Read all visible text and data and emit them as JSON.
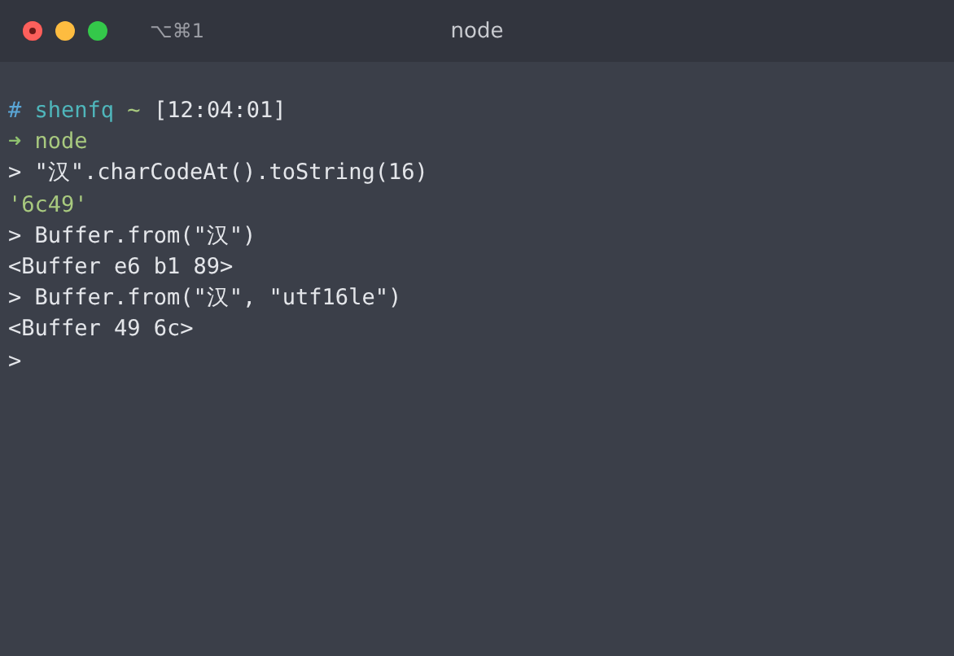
{
  "window": {
    "title": "node",
    "shortcut": "⌥⌘1"
  },
  "lines": [
    {
      "segments": [
        {
          "kind": "hash",
          "text": "#"
        },
        {
          "kind": "user",
          "text": " shenfq"
        },
        {
          "kind": "tilde",
          "text": " ~"
        },
        {
          "kind": "plain",
          "text": " [12:04:01]"
        }
      ]
    },
    {
      "segments": [
        {
          "kind": "arrow",
          "text": "➜"
        },
        {
          "kind": "command",
          "text": " node"
        }
      ]
    },
    {
      "segments": [
        {
          "kind": "plain",
          "text": "> \"汉\".charCodeAt().toString(16)"
        }
      ]
    },
    {
      "segments": [
        {
          "kind": "string",
          "text": "'6c49'"
        }
      ]
    },
    {
      "segments": [
        {
          "kind": "plain",
          "text": "> Buffer.from(\"汉\")"
        }
      ]
    },
    {
      "segments": [
        {
          "kind": "plain",
          "text": "<Buffer e6 b1 89>"
        }
      ]
    },
    {
      "segments": [
        {
          "kind": "plain",
          "text": "> Buffer.from(\"汉\", \"utf16le\")"
        }
      ]
    },
    {
      "segments": [
        {
          "kind": "plain",
          "text": "<Buffer 49 6c>"
        }
      ]
    },
    {
      "segments": [
        {
          "kind": "plain",
          "text": ">"
        }
      ]
    }
  ]
}
